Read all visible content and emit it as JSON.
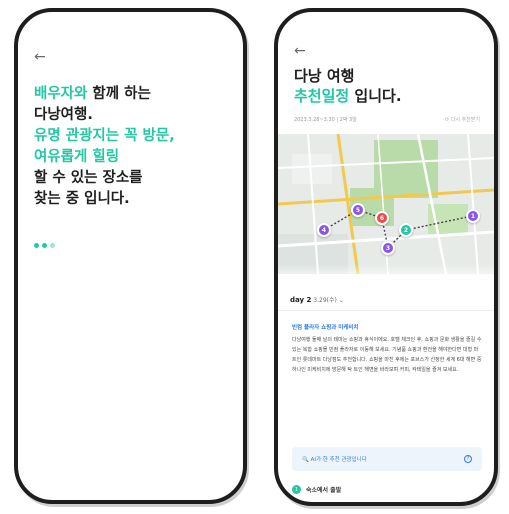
{
  "left_screen": {
    "back_icon": "arrow-left-icon",
    "lines": [
      {
        "parts": [
          {
            "text": "배우자와",
            "highlight": true
          },
          {
            "text": " 함께 하는",
            "highlight": false
          }
        ]
      },
      {
        "parts": [
          {
            "text": "다낭여행.",
            "highlight": false
          }
        ]
      },
      {
        "parts": [
          {
            "text": "유명 관광지는 꼭 방문,",
            "highlight": true
          }
        ]
      },
      {
        "parts": [
          {
            "text": "여유롭게 힐링",
            "highlight": true
          }
        ]
      },
      {
        "parts": [
          {
            "text": "할 수 있는 장소를",
            "highlight": false
          }
        ]
      },
      {
        "parts": [
          {
            "text": "찾는 중 입니다.",
            "highlight": false
          }
        ]
      }
    ],
    "loading_indicator": "loading-dots",
    "accent_color": "#22c7a3"
  },
  "right_screen": {
    "back_icon": "arrow-left-icon",
    "title": "다낭 여행",
    "subtitle_highlight": "추천일정",
    "subtitle_rest": " 입니다.",
    "meta": "2023.3.28~3.30 | 2박 3일",
    "meta_right": "⟳ 다시 추천받기",
    "map_pins": [
      {
        "label": "1",
        "color": "purple"
      },
      {
        "label": "2",
        "color": "teal"
      },
      {
        "label": "3",
        "color": "purple"
      },
      {
        "label": "4",
        "color": "purple"
      },
      {
        "label": "5",
        "color": "purple"
      },
      {
        "label": "6",
        "color": "red"
      }
    ],
    "day_label": "day 2",
    "day_date": " 3.29(수) ⌄",
    "place_name": "빈컴 플라자 쇼핑과 미케비치",
    "description": "다낭여행 둘째 날의 테마는 쇼핑과 휴식이에요. 호텔 체크인 후, 쇼핑과 문화 생활을 즐길 수 있는 복합 쇼핑몰 빈컴 플라자로 이동해 보세요. 기념품 쇼핑과 환전을 해야한다면 대형 마트인 롯데마트 다낭점도 추천합니다. 쇼핑을 마친 후에는 포브스가 선정한 세계 6대 해변 중 하나인 미케비치에 방문해 탁 트인 해변을 바라보며 커피, 칵테일을 즐겨 보세요.",
    "ai_notice": "🔍 AI가 한 추천 관광입니다",
    "ai_help_icon": "help-icon",
    "depart_number": "1",
    "depart_label": "숙소에서 출발",
    "accent_color": "#22c7a3",
    "link_color": "#2f7de1"
  }
}
